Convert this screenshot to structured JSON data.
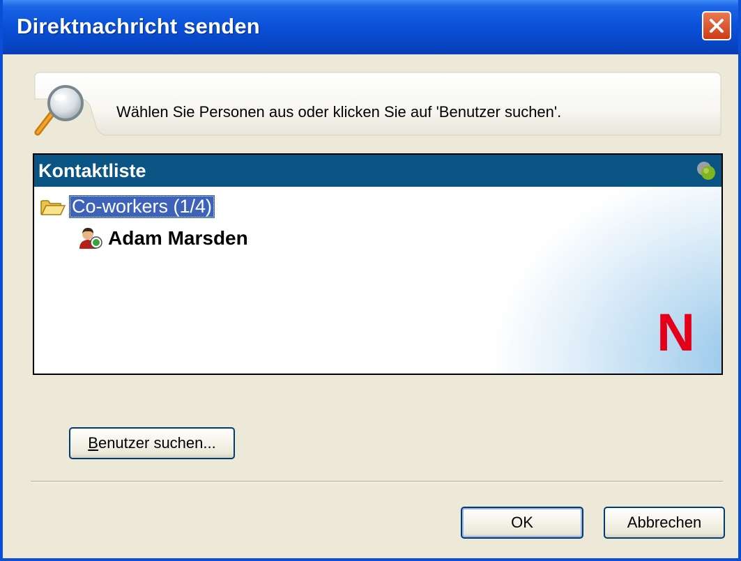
{
  "window": {
    "title": "Direktnachricht senden",
    "close_label": "Close"
  },
  "banner": {
    "instruction": "Wählen Sie Personen aus oder klicken Sie auf 'Benutzer suchen'."
  },
  "contact_list": {
    "header": "Kontaktliste",
    "groups": [
      {
        "label": "Co-workers  (1/4)",
        "expanded": true,
        "selected": true,
        "contacts": [
          {
            "name": "Adam Marsden",
            "status": "online"
          }
        ]
      }
    ],
    "logo_letter": "N"
  },
  "buttons": {
    "search_users_prefix": "B",
    "search_users_rest": "enutzer suchen...",
    "ok": "OK",
    "cancel": "Abbrechen"
  },
  "colors": {
    "titlebar_blue": "#0a52d8",
    "list_header": "#0b5584",
    "selection": "#3c63b9",
    "logo_red": "#e30018",
    "dialog_bg": "#ece9d8"
  }
}
